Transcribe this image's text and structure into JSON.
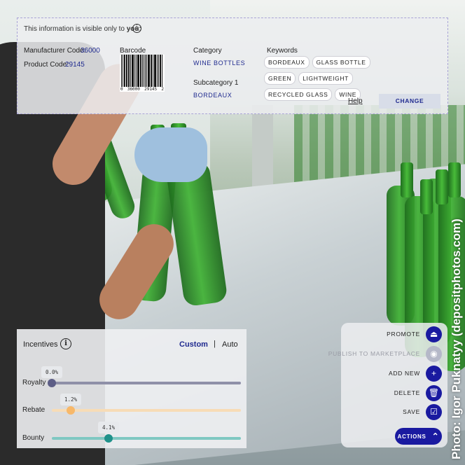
{
  "info_panel": {
    "visibility_note_prefix": "This information is visible only to ",
    "visibility_note_emphasis": "you:",
    "info_icon_glyph": "i",
    "manufacturer_code_label": "Manufacturer Code:",
    "manufacturer_code": "36000",
    "product_code_label": "Product Code:",
    "product_code": "29145",
    "barcode_label": "Barcode",
    "barcode_digits": [
      "0",
      "36000",
      "29145",
      "2"
    ],
    "category_label": "Category",
    "category": "WINE BOTTLES",
    "subcategory_label": "Subcategory 1",
    "subcategory": "BORDEAUX",
    "keywords_label": "Keywords",
    "keywords": [
      "BORDEAUX",
      "GLASS BOTTLE",
      "GREEN",
      "LIGHTWEIGHT",
      "RECYCLED GLASS",
      "WINE"
    ],
    "help_label": "Help",
    "change_label": "CHANGE"
  },
  "incentives": {
    "title": "Incentives",
    "info_icon_glyph": "i",
    "mode_custom": "Custom",
    "mode_separator": "|",
    "mode_auto": "Auto",
    "sliders": [
      {
        "label": "Royalty",
        "value_text": "0.0%",
        "percent": 0,
        "color": "#8f90a8",
        "knob_color": "#5c5d86"
      },
      {
        "label": "Rebate",
        "value_text": "1.2%",
        "percent": 10,
        "color": "#f7dcb6",
        "knob_color": "#f7b86a"
      },
      {
        "label": "Bounty",
        "value_text": "4.1%",
        "percent": 30,
        "color": "#7fc8c2",
        "knob_color": "#20918a"
      }
    ]
  },
  "actions": {
    "items": [
      {
        "label": "PROMOTE",
        "icon": "eject-icon",
        "glyph": "⏏",
        "enabled": true
      },
      {
        "label": "PUBLISH TO MARKETPLACE",
        "icon": "eye-icon",
        "glyph": "◉",
        "enabled": false
      },
      {
        "label": "ADD NEW",
        "icon": "plus-icon",
        "glyph": "+",
        "enabled": true
      },
      {
        "label": "DELETE",
        "icon": "trash-icon",
        "glyph": "🗑",
        "enabled": true
      },
      {
        "label": "SAVE",
        "icon": "save-icon",
        "glyph": "☑",
        "enabled": true
      }
    ],
    "menu_label": "ACTIONS",
    "menu_icon": "chevrons-up-icon",
    "menu_glyph": "⌃"
  },
  "photo_credit": "Photo: Igor Puknatyy (depositphotos.com)",
  "colors": {
    "accent": "#1a1aa0",
    "link": "#1f2a8f",
    "bottle_green": "#3fb233"
  }
}
